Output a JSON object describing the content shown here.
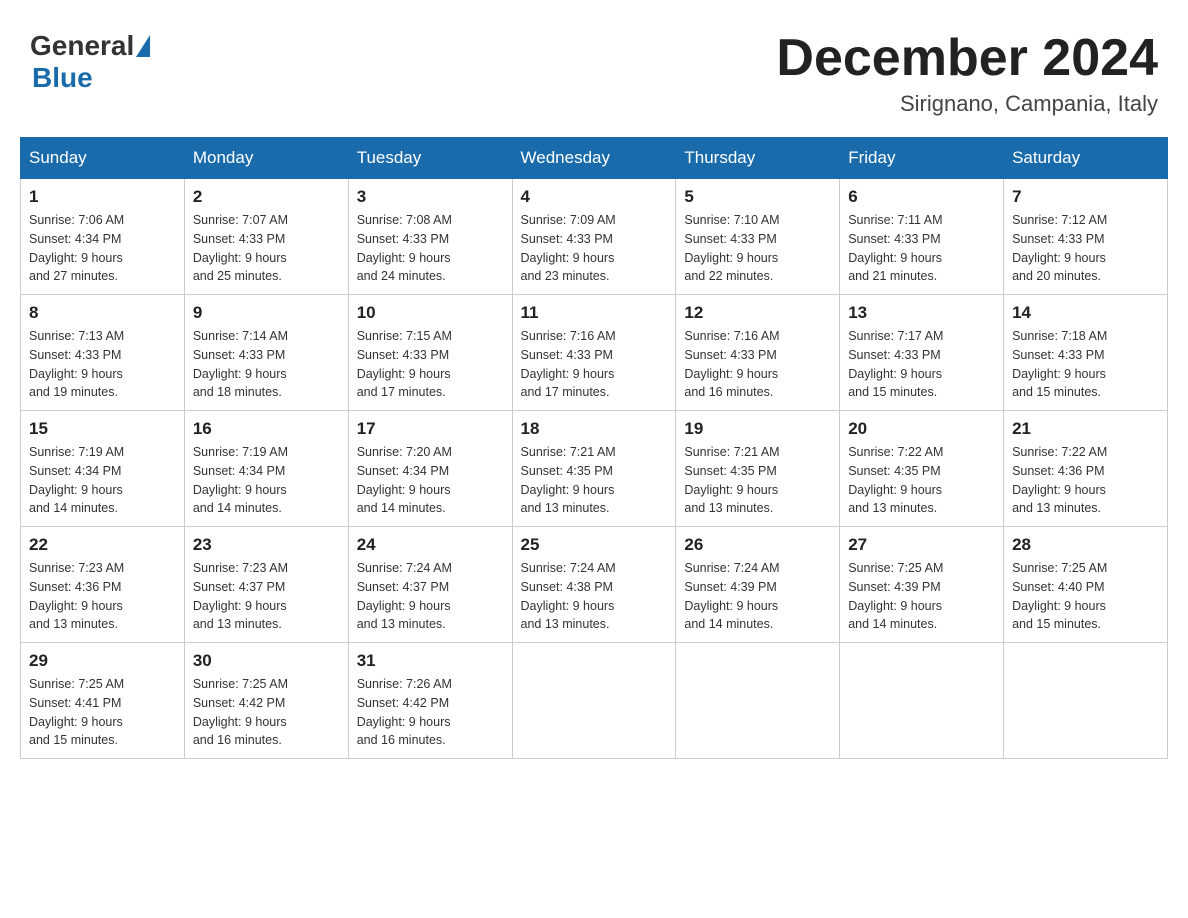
{
  "header": {
    "logo_general": "General",
    "logo_blue": "Blue",
    "month_title": "December 2024",
    "location": "Sirignano, Campania, Italy"
  },
  "weekdays": [
    "Sunday",
    "Monday",
    "Tuesday",
    "Wednesday",
    "Thursday",
    "Friday",
    "Saturday"
  ],
  "weeks": [
    [
      {
        "day": "1",
        "sunrise": "7:06 AM",
        "sunset": "4:34 PM",
        "daylight": "9 hours and 27 minutes."
      },
      {
        "day": "2",
        "sunrise": "7:07 AM",
        "sunset": "4:33 PM",
        "daylight": "9 hours and 25 minutes."
      },
      {
        "day": "3",
        "sunrise": "7:08 AM",
        "sunset": "4:33 PM",
        "daylight": "9 hours and 24 minutes."
      },
      {
        "day": "4",
        "sunrise": "7:09 AM",
        "sunset": "4:33 PM",
        "daylight": "9 hours and 23 minutes."
      },
      {
        "day": "5",
        "sunrise": "7:10 AM",
        "sunset": "4:33 PM",
        "daylight": "9 hours and 22 minutes."
      },
      {
        "day": "6",
        "sunrise": "7:11 AM",
        "sunset": "4:33 PM",
        "daylight": "9 hours and 21 minutes."
      },
      {
        "day": "7",
        "sunrise": "7:12 AM",
        "sunset": "4:33 PM",
        "daylight": "9 hours and 20 minutes."
      }
    ],
    [
      {
        "day": "8",
        "sunrise": "7:13 AM",
        "sunset": "4:33 PM",
        "daylight": "9 hours and 19 minutes."
      },
      {
        "day": "9",
        "sunrise": "7:14 AM",
        "sunset": "4:33 PM",
        "daylight": "9 hours and 18 minutes."
      },
      {
        "day": "10",
        "sunrise": "7:15 AM",
        "sunset": "4:33 PM",
        "daylight": "9 hours and 17 minutes."
      },
      {
        "day": "11",
        "sunrise": "7:16 AM",
        "sunset": "4:33 PM",
        "daylight": "9 hours and 17 minutes."
      },
      {
        "day": "12",
        "sunrise": "7:16 AM",
        "sunset": "4:33 PM",
        "daylight": "9 hours and 16 minutes."
      },
      {
        "day": "13",
        "sunrise": "7:17 AM",
        "sunset": "4:33 PM",
        "daylight": "9 hours and 15 minutes."
      },
      {
        "day": "14",
        "sunrise": "7:18 AM",
        "sunset": "4:33 PM",
        "daylight": "9 hours and 15 minutes."
      }
    ],
    [
      {
        "day": "15",
        "sunrise": "7:19 AM",
        "sunset": "4:34 PM",
        "daylight": "9 hours and 14 minutes."
      },
      {
        "day": "16",
        "sunrise": "7:19 AM",
        "sunset": "4:34 PM",
        "daylight": "9 hours and 14 minutes."
      },
      {
        "day": "17",
        "sunrise": "7:20 AM",
        "sunset": "4:34 PM",
        "daylight": "9 hours and 14 minutes."
      },
      {
        "day": "18",
        "sunrise": "7:21 AM",
        "sunset": "4:35 PM",
        "daylight": "9 hours and 13 minutes."
      },
      {
        "day": "19",
        "sunrise": "7:21 AM",
        "sunset": "4:35 PM",
        "daylight": "9 hours and 13 minutes."
      },
      {
        "day": "20",
        "sunrise": "7:22 AM",
        "sunset": "4:35 PM",
        "daylight": "9 hours and 13 minutes."
      },
      {
        "day": "21",
        "sunrise": "7:22 AM",
        "sunset": "4:36 PM",
        "daylight": "9 hours and 13 minutes."
      }
    ],
    [
      {
        "day": "22",
        "sunrise": "7:23 AM",
        "sunset": "4:36 PM",
        "daylight": "9 hours and 13 minutes."
      },
      {
        "day": "23",
        "sunrise": "7:23 AM",
        "sunset": "4:37 PM",
        "daylight": "9 hours and 13 minutes."
      },
      {
        "day": "24",
        "sunrise": "7:24 AM",
        "sunset": "4:37 PM",
        "daylight": "9 hours and 13 minutes."
      },
      {
        "day": "25",
        "sunrise": "7:24 AM",
        "sunset": "4:38 PM",
        "daylight": "9 hours and 13 minutes."
      },
      {
        "day": "26",
        "sunrise": "7:24 AM",
        "sunset": "4:39 PM",
        "daylight": "9 hours and 14 minutes."
      },
      {
        "day": "27",
        "sunrise": "7:25 AM",
        "sunset": "4:39 PM",
        "daylight": "9 hours and 14 minutes."
      },
      {
        "day": "28",
        "sunrise": "7:25 AM",
        "sunset": "4:40 PM",
        "daylight": "9 hours and 15 minutes."
      }
    ],
    [
      {
        "day": "29",
        "sunrise": "7:25 AM",
        "sunset": "4:41 PM",
        "daylight": "9 hours and 15 minutes."
      },
      {
        "day": "30",
        "sunrise": "7:25 AM",
        "sunset": "4:42 PM",
        "daylight": "9 hours and 16 minutes."
      },
      {
        "day": "31",
        "sunrise": "7:26 AM",
        "sunset": "4:42 PM",
        "daylight": "9 hours and 16 minutes."
      },
      null,
      null,
      null,
      null
    ]
  ]
}
